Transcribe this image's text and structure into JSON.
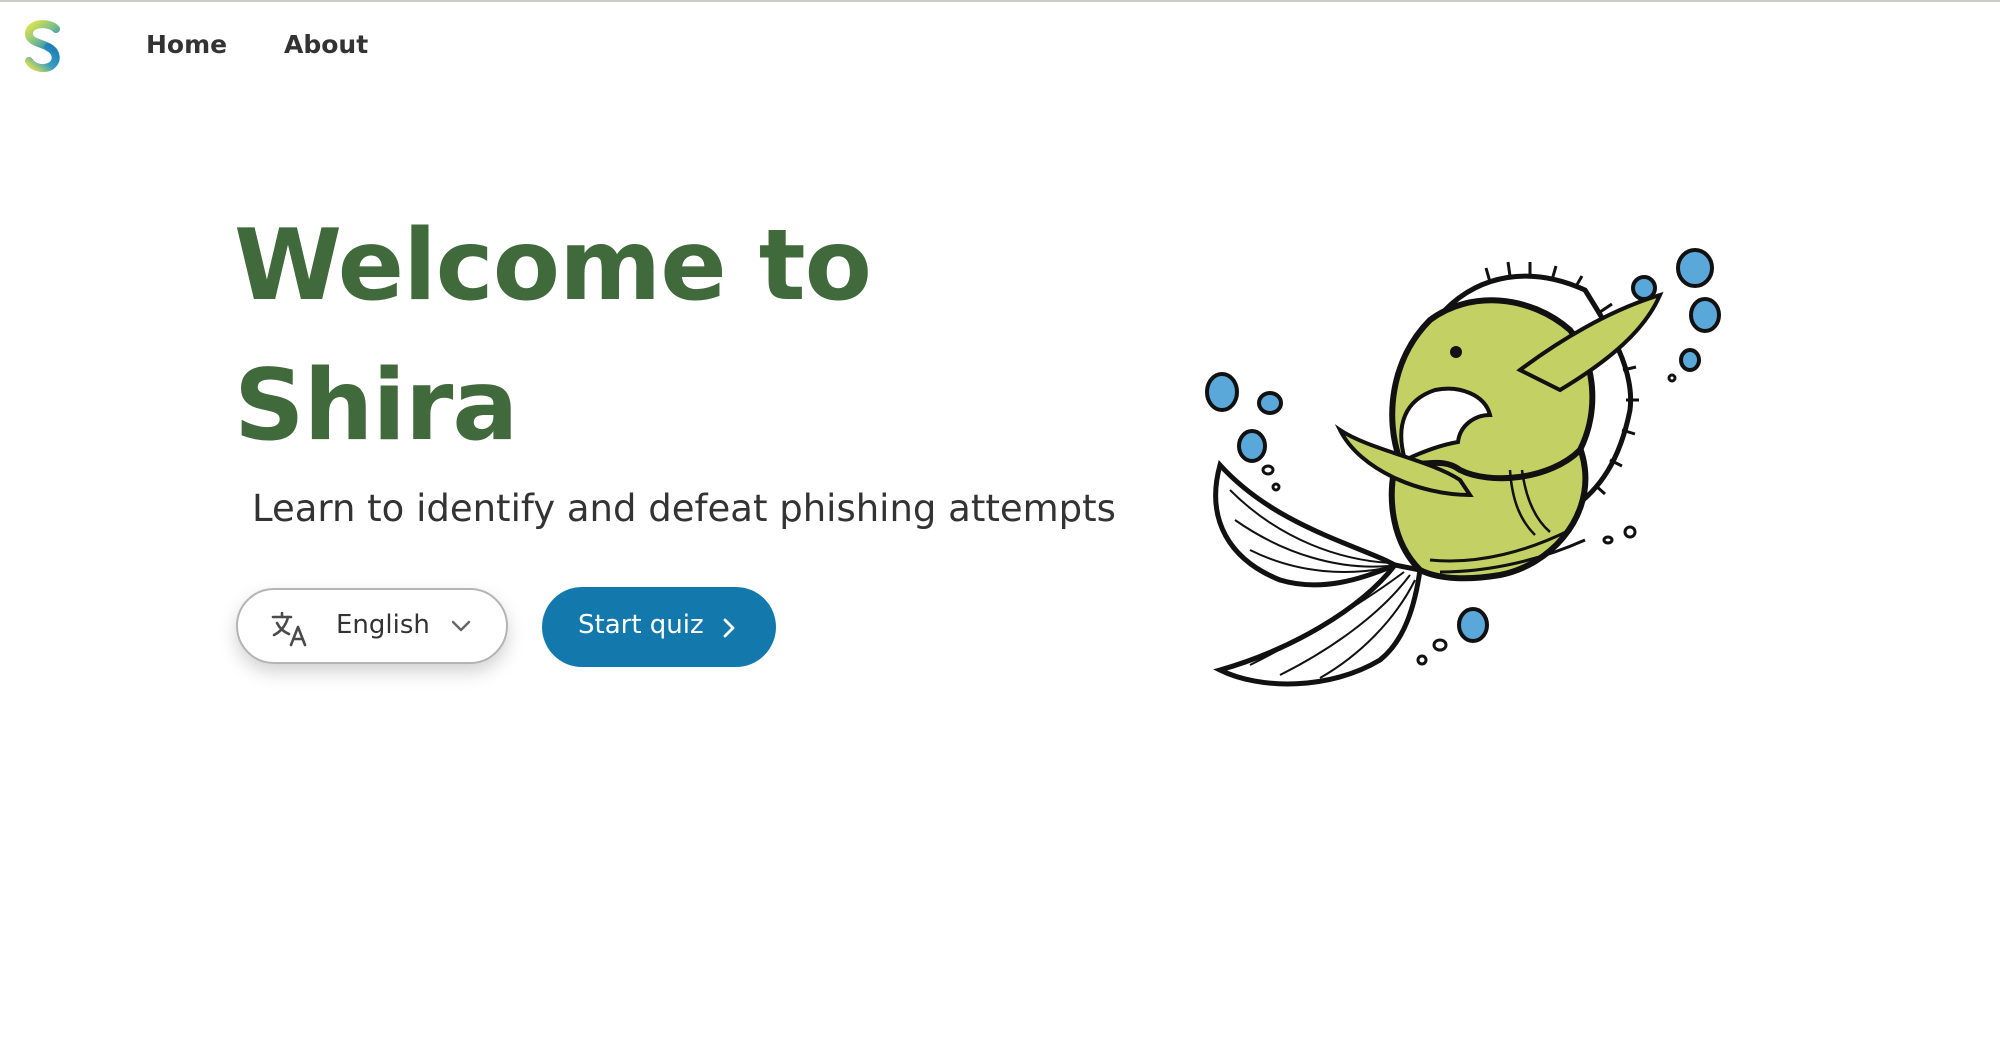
{
  "nav": {
    "logo_icon": "shira-s-logo-icon",
    "home_label": "Home",
    "about_label": "About"
  },
  "hero": {
    "title_line1": "Welcome to",
    "title_line2": "Shira",
    "subtitle": "Learn to identify and defeat phishing attempts"
  },
  "language_select": {
    "icon": "translate-icon",
    "selected": "English",
    "chevron_icon": "chevron-down-icon"
  },
  "start_button": {
    "label": "Start quiz",
    "icon": "chevron-right-icon"
  },
  "illustration": {
    "icon": "fish-mascot-illustration"
  },
  "colors": {
    "title_green": "#40693c",
    "primary_blue": "#1379ad",
    "fish_green": "#c3d164",
    "bubble_blue": "#5aa8da"
  }
}
